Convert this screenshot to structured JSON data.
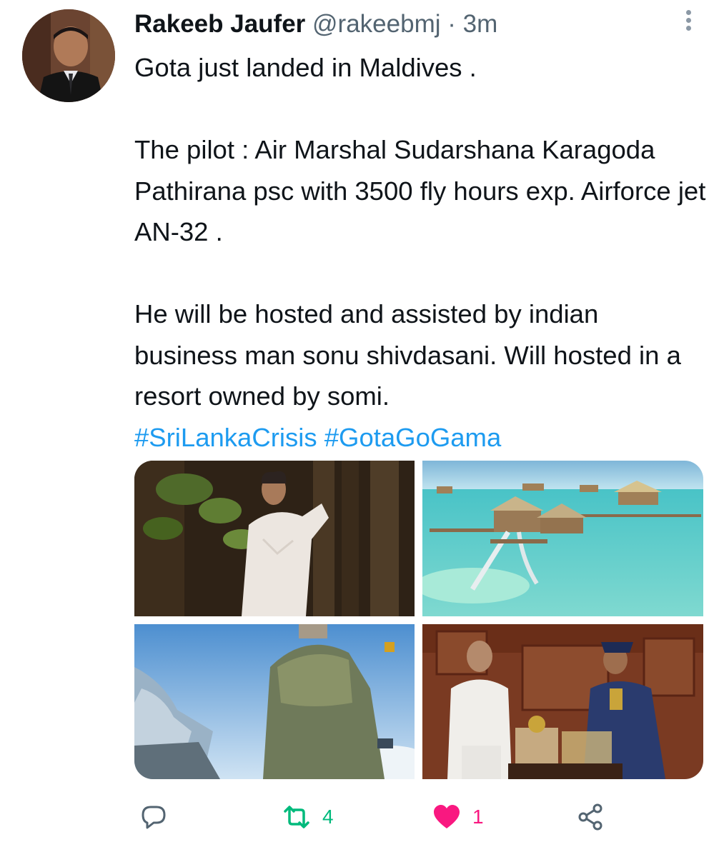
{
  "tweet": {
    "author": {
      "display_name": "Rakeeb Jaufer",
      "handle": "@rakeebmj",
      "separator": "·",
      "timestamp": "3m"
    },
    "text": {
      "line1": "Gota just landed in Maldives .",
      "para2": "The pilot : Air Marshal Sudarshana Karagoda Pathirana psc with 3500 fly hours exp. Airforce jet AN-32 .",
      "para3": "He will be hosted and assisted by indian business man sonu shivdasani. Will hosted in a resort owned by somi.",
      "hashtags": [
        "#SriLankaCrisis",
        "#GotaGoGama"
      ]
    },
    "media_count": 4,
    "actions": {
      "reply_icon": "reply-icon",
      "retweet_icon": "retweet-icon",
      "retweet_count": "4",
      "like_icon": "heart-icon",
      "like_count": "1",
      "share_icon": "share-icon"
    }
  },
  "colors": {
    "hashtag": "#1d9bf0",
    "retweet": "#00ba7c",
    "like": "#f91880",
    "secondary_text": "#536471",
    "primary_text": "#0f1419"
  }
}
